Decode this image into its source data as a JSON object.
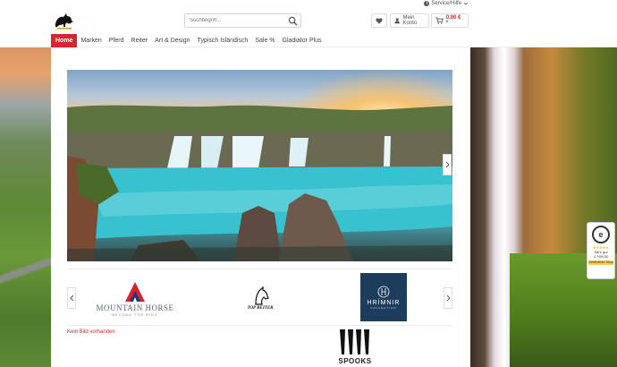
{
  "header": {
    "service_label": "Service/Hilfe",
    "search_placeholder": "Suchbegriff...",
    "account_label": "Mein Konto",
    "cart_price": "0,00 €",
    "cart_suffix": "*"
  },
  "nav": {
    "items": [
      "Home",
      "Marken",
      "Pferd",
      "Reiter",
      "Art & Design",
      "Typisch Isländisch",
      "Sale %",
      "Gladiator Plus"
    ],
    "active_index": 0
  },
  "brands": {
    "items": [
      {
        "name": "MOUNTAIN HORSE",
        "tagline": "BEYOND THE RIDE"
      },
      {
        "name": "TOP REITER"
      },
      {
        "name": "HRÍMNIR",
        "tagline": "COLLECTION"
      }
    ]
  },
  "content": {
    "missing_image_text": "Kein Bild vorhanden",
    "spooks_name": "SPOOKS"
  },
  "trust_badge": {
    "seal_letter": "e",
    "stars": "★★★★★",
    "rating_word": "Sehr gut",
    "rating_value": "4.79/5.00",
    "shop_label": "Zertifizierter Shop"
  },
  "colors": {
    "accent": "#d9262e",
    "hrimnir_bg": "#1d3d5d"
  }
}
